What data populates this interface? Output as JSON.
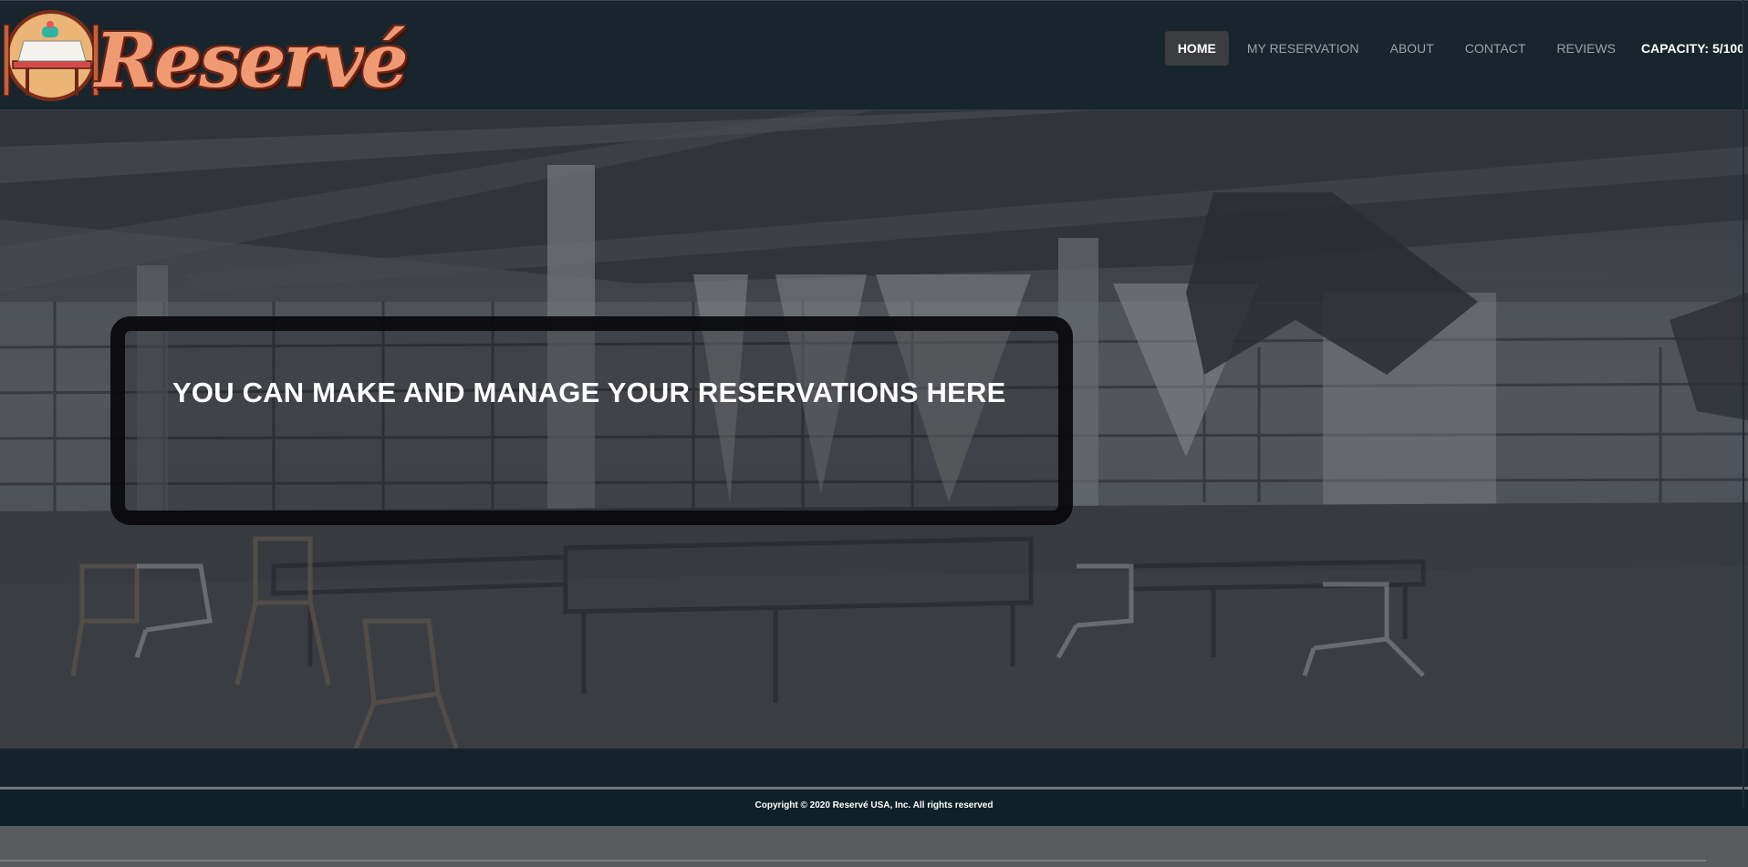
{
  "brand": {
    "name": "Reservé",
    "primary": "#f09a74",
    "outline": "#6b2416"
  },
  "nav": {
    "items": [
      {
        "label": "HOME",
        "active": true
      },
      {
        "label": "MY RESERVATION",
        "active": false
      },
      {
        "label": "ABOUT",
        "active": false
      },
      {
        "label": "CONTACT",
        "active": false
      },
      {
        "label": "REVIEWS",
        "active": false
      }
    ],
    "capacity": "CAPACITY: 5/100"
  },
  "hero": {
    "headline": "YOU CAN MAKE AND MANAGE YOUR RESERVATIONS HERE"
  },
  "footer": {
    "copyright": "Copyright © 2020 Reservé USA, Inc. All rights reserved"
  },
  "colors": {
    "header_bg": "#18252c",
    "footer_bg": "#0f2128",
    "active_tab": "#3b3d40"
  }
}
